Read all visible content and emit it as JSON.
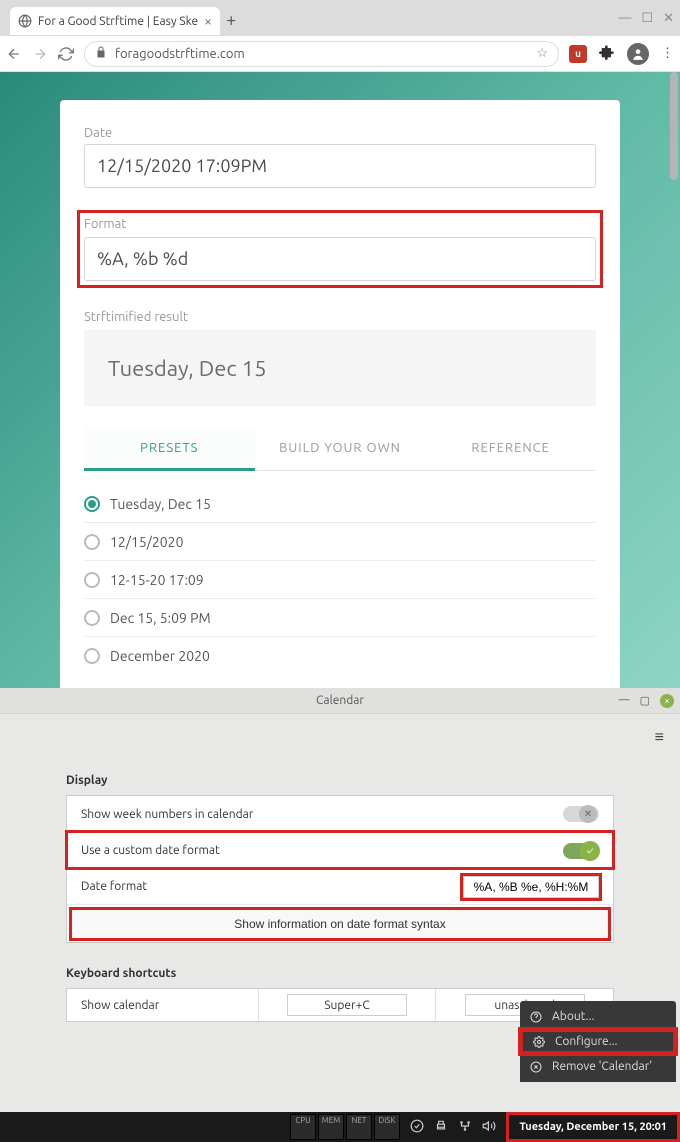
{
  "browser": {
    "tab_title": "For a Good Strftime | Easy Ske",
    "url": "foragoodstrftime.com"
  },
  "page": {
    "date_label": "Date",
    "date_value": "12/15/2020 17:09PM",
    "format_label": "Format",
    "format_value": "%A, %b %d",
    "result_label": "Strftimified result",
    "result_value": "Tuesday, Dec 15",
    "tabs": {
      "presets": "PRESETS",
      "byo": "BUILD YOUR OWN",
      "ref": "REFERENCE"
    },
    "presets": [
      {
        "label": "Tuesday, Dec 15",
        "selected": true
      },
      {
        "label": "12/15/2020",
        "selected": false
      },
      {
        "label": "12-15-20 17:09",
        "selected": false
      },
      {
        "label": "Dec 15, 5:09 PM",
        "selected": false
      },
      {
        "label": "December 2020",
        "selected": false
      }
    ]
  },
  "calendar": {
    "title": "Calendar",
    "section_display": "Display",
    "row_weeknums": "Show week numbers in calendar",
    "row_customfmt": "Use a custom date format",
    "row_datefmt_label": "Date format",
    "row_datefmt_value": "%A, %B %e, %H:%M",
    "info_button": "Show information on date format syntax",
    "section_kbd": "Keyboard shortcuts",
    "kbd_rows": [
      {
        "label": "Show calendar",
        "key1": "Super+C",
        "key2": "unassigned"
      }
    ]
  },
  "ctx": {
    "about": "About...",
    "configure": "Configure...",
    "remove": "Remove 'Calendar'"
  },
  "taskbar": {
    "meters": [
      "CPU",
      "MEM",
      "NET",
      "DISK"
    ],
    "clock": "Tuesday, December 15, 20:01"
  }
}
